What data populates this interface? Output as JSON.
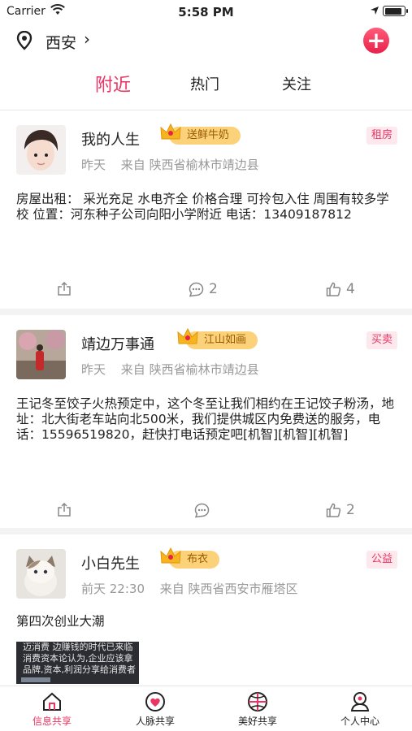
{
  "status_bar": {
    "carrier": "Carrier",
    "time": "5:58 PM"
  },
  "navbar": {
    "city": "西安",
    "chevron": "›",
    "add_button": "+"
  },
  "tabs": [
    {
      "label": "附近",
      "active": true
    },
    {
      "label": "热门",
      "active": false
    },
    {
      "label": "关注",
      "active": false
    }
  ],
  "posts": [
    {
      "name": "我的人生",
      "badge": "送鲜牛奶",
      "tag": "租房",
      "time": "昨天",
      "location": "来自 陕西省榆林市靖边县",
      "content": "房屋出租：    采光充足  水电齐全   价格合理    可拎包入住  周围有较多学校    位置：河东种子公司向阳小学附近    电话：13409187812",
      "comments": "2",
      "likes": "4"
    },
    {
      "name": "靖边万事通",
      "badge": "江山如画",
      "tag": "买卖",
      "time": "昨天",
      "location": "来自 陕西省榆林市靖边县",
      "content": "王记冬至饺子火热预定中，这个冬至让我们相约在王记饺子粉汤，地址：北大街老车站向北500米，我们提供城区内免费送的服务，电话：15596519820，赶快打电话预定吧[机智][机智][机智]",
      "comments": "",
      "likes": "2"
    },
    {
      "name": "小白先生",
      "badge": "布衣",
      "tag": "公益",
      "time": "前天 22:30",
      "location": "来自 陕西省西安市雁塔区",
      "content": "第四次创业大潮",
      "image_lines": [
        "迈消费 边赚钱的时代已来临",
        "消费资本论认为,企业应该拿",
        "品牌,资本,利润分享给消费者"
      ]
    }
  ],
  "tabbar": [
    {
      "label": "信息共享",
      "active": true
    },
    {
      "label": "人脉共享",
      "active": false
    },
    {
      "label": "美好共享",
      "active": false
    },
    {
      "label": "个人中心",
      "active": false
    }
  ],
  "colors": {
    "accent": "#ea3462",
    "badge": "#fbd27a"
  }
}
